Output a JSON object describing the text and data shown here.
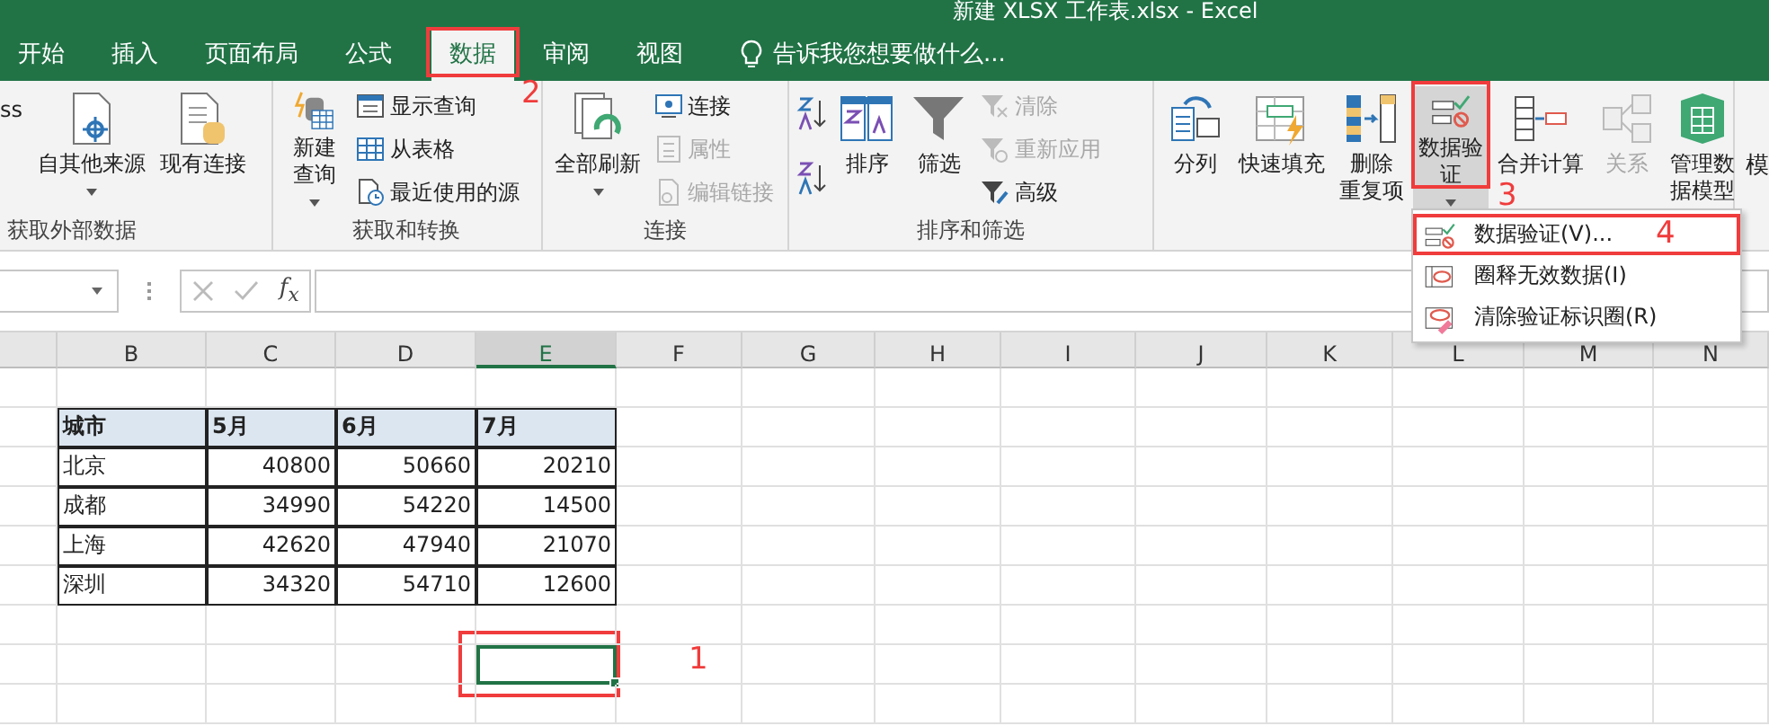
{
  "window": {
    "title": "新建 XLSX 工作表.xlsx - Excel"
  },
  "tabs": [
    {
      "label": "开始",
      "selected": false
    },
    {
      "label": "插入",
      "selected": false
    },
    {
      "label": "页面布局",
      "selected": false
    },
    {
      "label": "公式",
      "selected": false
    },
    {
      "label": "数据",
      "selected": true,
      "annotation": "2"
    },
    {
      "label": "审阅",
      "selected": false
    },
    {
      "label": "视图",
      "selected": false
    }
  ],
  "tell_me": "告诉我您想要做什么...",
  "ribbon": {
    "cut_left": "ss",
    "cut_right": "模",
    "groups": [
      {
        "label": "获取外部数据",
        "items": [
          {
            "kind": "large",
            "lines": [
              "自其他来源"
            ],
            "dropdown": true,
            "disabled": false
          },
          {
            "kind": "large",
            "lines": [
              "现有连接"
            ],
            "dropdown": false,
            "disabled": false
          }
        ]
      },
      {
        "label": "获取和转换",
        "items": [
          {
            "kind": "large",
            "lines": [
              "新建",
              "查询"
            ],
            "dropdown": true,
            "disabled": false
          },
          {
            "kind": "stack",
            "items": [
              {
                "label": "显示查询",
                "disabled": false
              },
              {
                "label": "从表格",
                "disabled": false
              },
              {
                "label": "最近使用的源",
                "disabled": false
              }
            ]
          }
        ]
      },
      {
        "label": "连接",
        "items": [
          {
            "kind": "large",
            "lines": [
              "全部刷新"
            ],
            "dropdown": true,
            "disabled": false
          },
          {
            "kind": "stack",
            "items": [
              {
                "label": "连接",
                "disabled": false
              },
              {
                "label": "属性",
                "disabled": true
              },
              {
                "label": "编辑链接",
                "disabled": true
              }
            ]
          }
        ]
      },
      {
        "label": "排序和筛选",
        "items": [
          {
            "kind": "sortpair"
          },
          {
            "kind": "large",
            "lines": [
              "排序"
            ],
            "dropdown": false,
            "disabled": false
          },
          {
            "kind": "large",
            "lines": [
              "筛选"
            ],
            "dropdown": false,
            "disabled": false
          },
          {
            "kind": "stack",
            "items": [
              {
                "label": "清除",
                "disabled": true
              },
              {
                "label": "重新应用",
                "disabled": true
              },
              {
                "label": "高级",
                "disabled": false
              }
            ]
          }
        ]
      },
      {
        "items": [
          {
            "kind": "large",
            "lines": [
              "分列"
            ],
            "dropdown": false,
            "disabled": false
          },
          {
            "kind": "large",
            "lines": [
              "快速填充"
            ],
            "dropdown": false,
            "disabled": false
          },
          {
            "kind": "large",
            "lines": [
              "删除",
              "重复项"
            ],
            "dropdown": false,
            "disabled": false
          },
          {
            "kind": "large",
            "lines": [
              "数据验",
              "证"
            ],
            "dropdown": true,
            "disabled": false,
            "pressed": true,
            "annotation": "3"
          },
          {
            "kind": "large",
            "lines": [
              "合并计算"
            ],
            "dropdown": false,
            "disabled": false
          },
          {
            "kind": "large",
            "lines": [
              "关系"
            ],
            "dropdown": false,
            "disabled": true
          },
          {
            "kind": "large",
            "lines": [
              "管理数",
              "据模型"
            ],
            "dropdown": false,
            "disabled": false
          }
        ]
      }
    ]
  },
  "menu": {
    "items": [
      {
        "label": "数据验证(V)...",
        "annotation": "4"
      },
      {
        "label": "圈释无效数据(I)"
      },
      {
        "label": "清除验证标识圈(R)"
      }
    ]
  },
  "formula_bar": {
    "fx": "f$_{x}$"
  },
  "columns": [
    {
      "label": "B",
      "selected": false
    },
    {
      "label": "C",
      "selected": false
    },
    {
      "label": "D",
      "selected": false
    },
    {
      "label": "E",
      "selected": true
    },
    {
      "label": "F",
      "selected": false
    },
    {
      "label": "G",
      "selected": false
    },
    {
      "label": "H",
      "selected": false
    },
    {
      "label": "I",
      "selected": false
    },
    {
      "label": "J",
      "selected": false
    },
    {
      "label": "K",
      "selected": false
    },
    {
      "label": "L",
      "selected": false
    },
    {
      "label": "M",
      "selected": false
    },
    {
      "label": "N",
      "selected": false
    }
  ],
  "table": {
    "header": [
      "城市",
      "5月",
      "6月",
      "7月"
    ],
    "rows": [
      [
        "北京",
        "40800",
        "50660",
        "20210"
      ],
      [
        "成都",
        "34990",
        "54220",
        "14500"
      ],
      [
        "上海",
        "42620",
        "47940",
        "21070"
      ],
      [
        "深圳",
        "34320",
        "54710",
        "12600"
      ]
    ]
  },
  "selected_cell": {
    "annotation": "1"
  }
}
